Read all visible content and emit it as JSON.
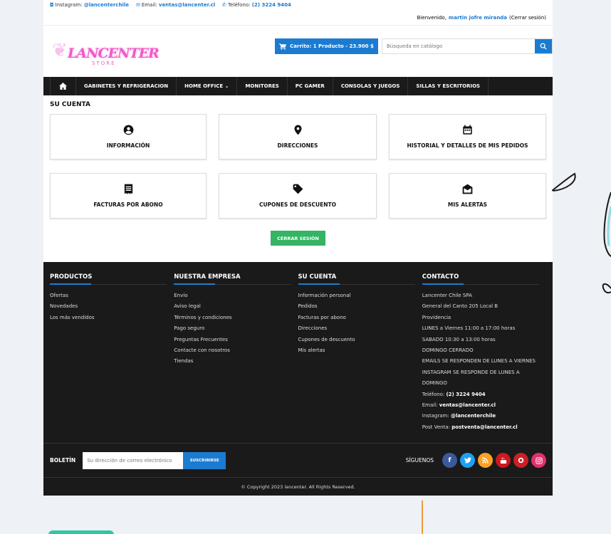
{
  "topbar": {
    "instagram_label": "Instagram:",
    "instagram_value": "@lancenterchile",
    "email_label": "Email:",
    "email_value": "ventas@lancenter.cl",
    "phone_label": "Teléfono:",
    "phone_value": "(2) 3224 9404"
  },
  "userbar": {
    "welcome": "Bienvenido,",
    "user_name": "martin jofre miranda",
    "logout_link": "(Cerrar sesión)"
  },
  "header": {
    "logo_text": "LANCENTER",
    "logo_sub": "STORE",
    "cart_label": "Carrito: 1 Producto - 23.900 $",
    "search_placeholder": "Búsqueda en catálogo"
  },
  "nav": {
    "items": [
      {
        "label": "GABINETES Y REFRIGERACION"
      },
      {
        "label": "HOME OFFICE ⌄"
      },
      {
        "label": "MONITORES"
      },
      {
        "label": "PC GAMER"
      },
      {
        "label": "CONSOLAS Y JUEGOS"
      },
      {
        "label": "SILLAS Y ESCRITORIOS"
      }
    ]
  },
  "account": {
    "title": "SU CUENTA",
    "tiles": [
      {
        "label": "INFORMACIÓN",
        "icon": "account-circle-icon"
      },
      {
        "label": "DIRECCIONES",
        "icon": "location-pin-icon"
      },
      {
        "label": "HISTORIAL Y DETALLES DE MIS PEDIDOS",
        "icon": "calendar-icon"
      },
      {
        "label": "FACTURAS POR ABONO",
        "icon": "receipt-icon"
      },
      {
        "label": "CUPONES DE DESCUENTO",
        "icon": "tag-icon"
      },
      {
        "label": "MIS ALERTAS",
        "icon": "open-envelope-icon"
      }
    ],
    "logout_button": "CERRAR SESIÓN"
  },
  "footer": {
    "productos": {
      "title": "PRODUCTOS",
      "links": [
        "Ofertas",
        "Novedades",
        "Los más vendidos"
      ]
    },
    "empresa": {
      "title": "NUESTRA EMPRESA",
      "links": [
        "Envío",
        "Aviso legal",
        "Términos y condiciones",
        "Pago seguro",
        "Preguntas Frecuentes",
        "Contacte con nosotros",
        "Tiendas"
      ]
    },
    "cuenta": {
      "title": "SU CUENTA",
      "links": [
        "Información personal",
        "Pedidos",
        "Facturas por abono",
        "Direcciones",
        "Cupones de descuento",
        "Mis alertas"
      ]
    },
    "contacto": {
      "title": "CONTACTO",
      "lines": [
        "Lancenter Chile SPA",
        "General del Canto 205 Local B",
        "Providencia",
        "LUNES a Viernes 11:00 a 17:00 horas",
        "SABADO 10:30 a 13:00 horas",
        "DOMINGO CERRADO",
        "EMAILS SE RESPONDEN DE LUNES A VIERNES",
        "INSTAGRAM SE RESPONDE DE LUNES A",
        "DOMINGO"
      ],
      "phone_label": "Teléfono:",
      "phone_value": "(2) 3224 9404",
      "email_label": "Email:",
      "email_value": "ventas@lancenter.cl",
      "ig_label": "Instagram:",
      "ig_value": "@lancenterchile",
      "pv_label": "Post Venta:",
      "pv_value": "postventa@lancenter.cl"
    },
    "newsletter": {
      "label": "BOLETÍN",
      "placeholder": "Su dirección de correo electrónico",
      "button": "SUSCRIBIRSE"
    },
    "social": {
      "label": "SÍGUENOS",
      "colors": {
        "facebook": "#3b5998",
        "twitter": "#1da1f2",
        "rss": "#f7a325",
        "youtube": "#cc181e",
        "pinterest": "#cb2027",
        "instagram": "#e1306c"
      }
    },
    "copyright": "© Copyright 2023 lancenter. All Rights Reserved."
  },
  "colors": {
    "accent": "#1b7bd1",
    "logout_green": "#34b464",
    "nav_bg": "#1a1a1a"
  }
}
